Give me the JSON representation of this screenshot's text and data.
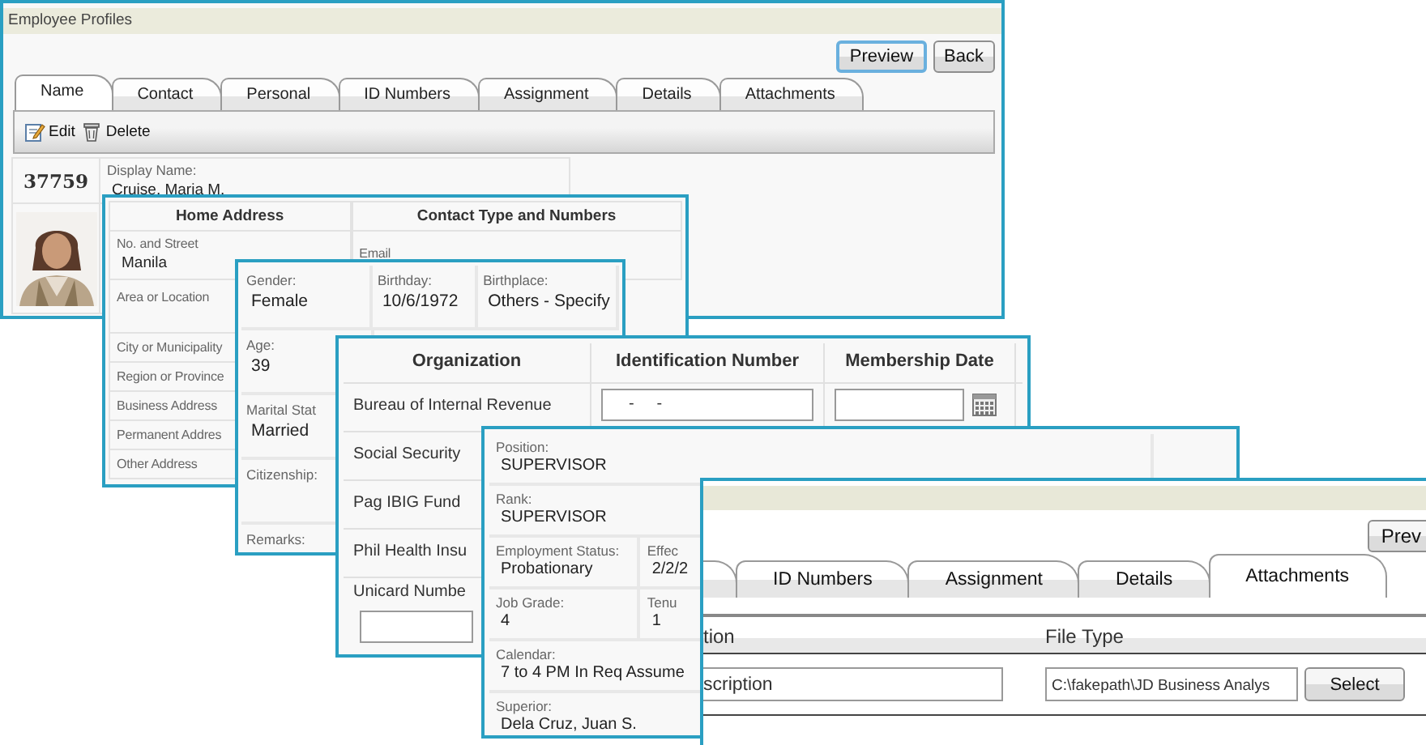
{
  "profile_window": {
    "title": "Employee Profiles",
    "buttons": [
      {
        "label": "Preview",
        "kind": "primary"
      },
      {
        "label": "Back",
        "kind": "default"
      }
    ],
    "tabs": [
      {
        "label": "Name",
        "selected": true
      },
      {
        "label": "Contact",
        "selected": false
      },
      {
        "label": "Personal",
        "selected": false
      },
      {
        "label": "ID Numbers",
        "selected": false
      },
      {
        "label": "Assignment",
        "selected": false
      },
      {
        "label": "Details",
        "selected": false
      },
      {
        "label": "Attachments",
        "selected": false
      }
    ],
    "toolbar": [
      {
        "label": "Edit",
        "kind": "edit"
      },
      {
        "label": "Delete",
        "kind": "delete"
      }
    ],
    "employee_id": "37759",
    "display_name": {
      "label": "Display Name:",
      "value": "Cruise, Maria M."
    }
  },
  "contact_panel": {
    "columns": [
      "Home Address",
      "Contact Type and Numbers"
    ],
    "address_rows": [
      {
        "label": "No. and Street",
        "value": "Manila"
      },
      {
        "label": "Area or Location"
      },
      {
        "label": "City or Municipality"
      },
      {
        "label": "Region or Province"
      },
      {
        "label": "Business Address"
      },
      {
        "label": "Permanent Addres"
      },
      {
        "label": "Other Address"
      }
    ],
    "contact_rows": [
      {
        "label": "Email"
      }
    ]
  },
  "personal_panel": {
    "rows": [
      [
        {
          "label": "Gender:",
          "value": "Female"
        },
        {
          "label": "Birthday:",
          "value": "10/6/1972"
        },
        {
          "label": "Birthplace:",
          "value": "Others - Specify"
        }
      ],
      [
        {
          "label": "Age:",
          "value": "39"
        }
      ],
      [
        {
          "label": "Marital Stat",
          "value": "Married"
        }
      ],
      [
        {
          "label": "Citizenship:"
        }
      ],
      [
        {
          "label": "Remarks:"
        }
      ]
    ]
  },
  "id_numbers_panel": {
    "columns": [
      "Organization",
      "Identification Number",
      "Membership Date"
    ],
    "rows": [
      {
        "organization": "Bureau of Internal Revenue",
        "id_value": "-     -",
        "kind": "inputs"
      },
      {
        "organization": "Social Security",
        "kind": "plain"
      },
      {
        "organization": "Pag IBIG Fund",
        "kind": "plain"
      },
      {
        "organization": "Phil Health Insu",
        "kind": "plain"
      },
      {
        "organization": "Unicard Numbe",
        "kind": "input_below"
      }
    ]
  },
  "assignment_panel": {
    "rows": [
      [
        {
          "label": "Position:",
          "value": "SUPERVISOR"
        }
      ],
      [
        {
          "label": "Rank:",
          "value": "SUPERVISOR"
        }
      ],
      [
        {
          "label": "Employment Status:",
          "value": "Probationary"
        },
        {
          "label": "Effec",
          "value": "2/2/2"
        }
      ],
      [
        {
          "label": "Job Grade:",
          "value": "4"
        },
        {
          "label": "Tenu",
          "value": "1"
        }
      ],
      [
        {
          "label": "Calendar:",
          "value": "7 to 4 PM In Req Assume"
        }
      ],
      [
        {
          "label": "Superior:",
          "value": "Dela Cruz, Juan S."
        }
      ]
    ]
  },
  "attachments_window": {
    "buttons": [
      {
        "label": "Prev"
      }
    ],
    "tabs": [
      {
        "label": "ID Numbers",
        "selected": false
      },
      {
        "label": "Assignment",
        "selected": false
      },
      {
        "label": "Details",
        "selected": false
      },
      {
        "label": "Attachments",
        "selected": true
      }
    ],
    "columns": [
      "tion",
      "File Type"
    ],
    "description": {
      "value": "scription"
    },
    "file": {
      "value": "C:\\fakepath\\JD Business Analys"
    },
    "select_button": "Select"
  }
}
